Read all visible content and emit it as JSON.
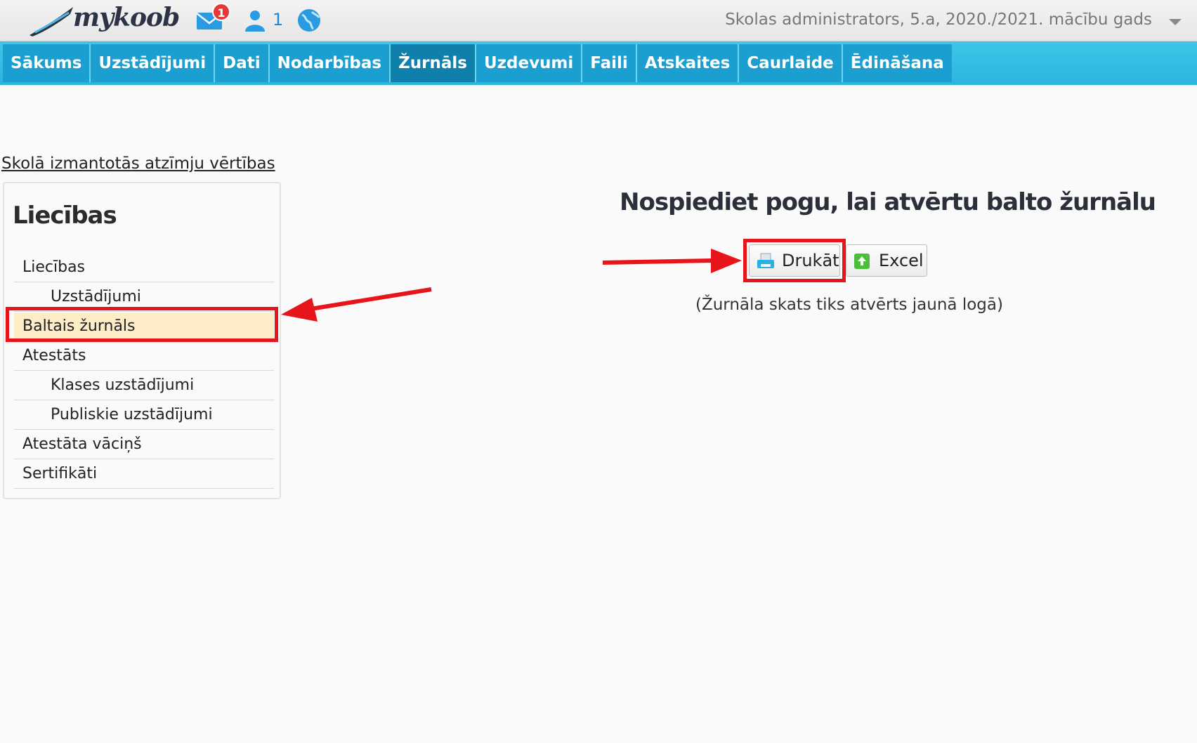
{
  "app": {
    "logo_text": "mykoob",
    "mail_badge_count": "1",
    "online_users_count": "1",
    "user_context": "Skolas administrators, 5.a, 2020./2021. mācību gads"
  },
  "nav": {
    "items": [
      {
        "label": "Sākums"
      },
      {
        "label": "Uzstādījumi"
      },
      {
        "label": "Dati"
      },
      {
        "label": "Nodarbības"
      },
      {
        "label": "Žurnāls",
        "active": true
      },
      {
        "label": "Uzdevumi"
      },
      {
        "label": "Faili"
      },
      {
        "label": "Atskaites"
      },
      {
        "label": "Caurlaide"
      },
      {
        "label": "Ēdināšana"
      }
    ]
  },
  "content": {
    "marks_link": "Skolā izmantotās atzīmju vērtības",
    "panel_title": "Liecības",
    "menu": [
      {
        "label": "Liecības",
        "level": 0
      },
      {
        "label": "Uzstādījumi",
        "level": 1
      },
      {
        "label": "Baltais žurnāls",
        "level": 0,
        "selected": true
      },
      {
        "label": "Atestāts",
        "level": 0
      },
      {
        "label": "Klases uzstādījumi",
        "level": 1
      },
      {
        "label": "Publiskie uzstādījumi",
        "level": 1
      },
      {
        "label": "Atestāta vāciņš",
        "level": 0
      },
      {
        "label": "Sertifikāti",
        "level": 0
      }
    ],
    "heading": "Nospiediet pogu, lai atvērtu balto žurnālu",
    "print_button": "Drukāt",
    "excel_button": "Excel",
    "hint": "(Žurnāla skats tiks atvērts jaunā logā)"
  },
  "colors": {
    "nav_bg": "#1a9fd0",
    "nav_active": "#0f7fab",
    "selected_row": "#fdecc6",
    "annotation_red": "#e8141c"
  }
}
